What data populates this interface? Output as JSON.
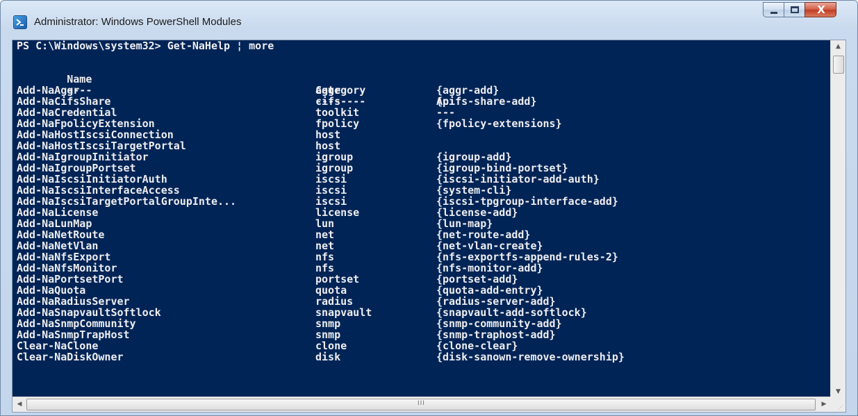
{
  "window": {
    "title": "Administrator: Windows PowerShell Modules",
    "close_label": "X"
  },
  "console": {
    "prompt": "PS C:\\Windows\\system32> Get-NaHelp ¦ more",
    "headers": {
      "name": "Name",
      "category": "Category",
      "api": "Api"
    },
    "underlines": {
      "name": "----",
      "category": "--------",
      "api": "---"
    },
    "rows": [
      {
        "name": "Add-NaAggr",
        "category": "aggr",
        "api": "{aggr-add}"
      },
      {
        "name": "Add-NaCifsShare",
        "category": "cifs",
        "api": "{cifs-share-add}"
      },
      {
        "name": "Add-NaCredential",
        "category": "toolkit",
        "api": ""
      },
      {
        "name": "Add-NaFpolicyExtension",
        "category": "fpolicy",
        "api": "{fpolicy-extensions}"
      },
      {
        "name": "Add-NaHostIscsiConnection",
        "category": "host",
        "api": ""
      },
      {
        "name": "Add-NaHostIscsiTargetPortal",
        "category": "host",
        "api": ""
      },
      {
        "name": "Add-NaIgroupInitiator",
        "category": "igroup",
        "api": "{igroup-add}"
      },
      {
        "name": "Add-NaIgroupPortset",
        "category": "igroup",
        "api": "{igroup-bind-portset}"
      },
      {
        "name": "Add-NaIscsiInitiatorAuth",
        "category": "iscsi",
        "api": "{iscsi-initiator-add-auth}"
      },
      {
        "name": "Add-NaIscsiInterfaceAccess",
        "category": "iscsi",
        "api": "{system-cli}"
      },
      {
        "name": "Add-NaIscsiTargetPortalGroupInte...",
        "category": "iscsi",
        "api": "{iscsi-tpgroup-interface-add}"
      },
      {
        "name": "Add-NaLicense",
        "category": "license",
        "api": "{license-add}"
      },
      {
        "name": "Add-NaLunMap",
        "category": "lun",
        "api": "{lun-map}"
      },
      {
        "name": "Add-NaNetRoute",
        "category": "net",
        "api": "{net-route-add}"
      },
      {
        "name": "Add-NaNetVlan",
        "category": "net",
        "api": "{net-vlan-create}"
      },
      {
        "name": "Add-NaNfsExport",
        "category": "nfs",
        "api": "{nfs-exportfs-append-rules-2}"
      },
      {
        "name": "Add-NaNfsMonitor",
        "category": "nfs",
        "api": "{nfs-monitor-add}"
      },
      {
        "name": "Add-NaPortsetPort",
        "category": "portset",
        "api": "{portset-add}"
      },
      {
        "name": "Add-NaQuota",
        "category": "quota",
        "api": "{quota-add-entry}"
      },
      {
        "name": "Add-NaRadiusServer",
        "category": "radius",
        "api": "{radius-server-add}"
      },
      {
        "name": "Add-NaSnapvaultSoftlock",
        "category": "snapvault",
        "api": "{snapvault-add-softlock}"
      },
      {
        "name": "Add-NaSnmpCommunity",
        "category": "snmp",
        "api": "{snmp-community-add}"
      },
      {
        "name": "Add-NaSnmpTrapHost",
        "category": "snmp",
        "api": "{snmp-traphost-add}"
      },
      {
        "name": "Clear-NaClone",
        "category": "clone",
        "api": "{clone-clear}"
      },
      {
        "name": "Clear-NaDiskOwner",
        "category": "disk",
        "api": "{disk-sanown-remove-ownership}"
      }
    ]
  },
  "colors": {
    "console_bg": "#012456",
    "console_fg": "#eeedf0"
  },
  "icons": {
    "app": "powershell-icon",
    "minimize": "minimize-icon",
    "maximize": "maximize-icon",
    "close": "close-icon"
  },
  "scrollbar": {
    "grip": "III"
  }
}
